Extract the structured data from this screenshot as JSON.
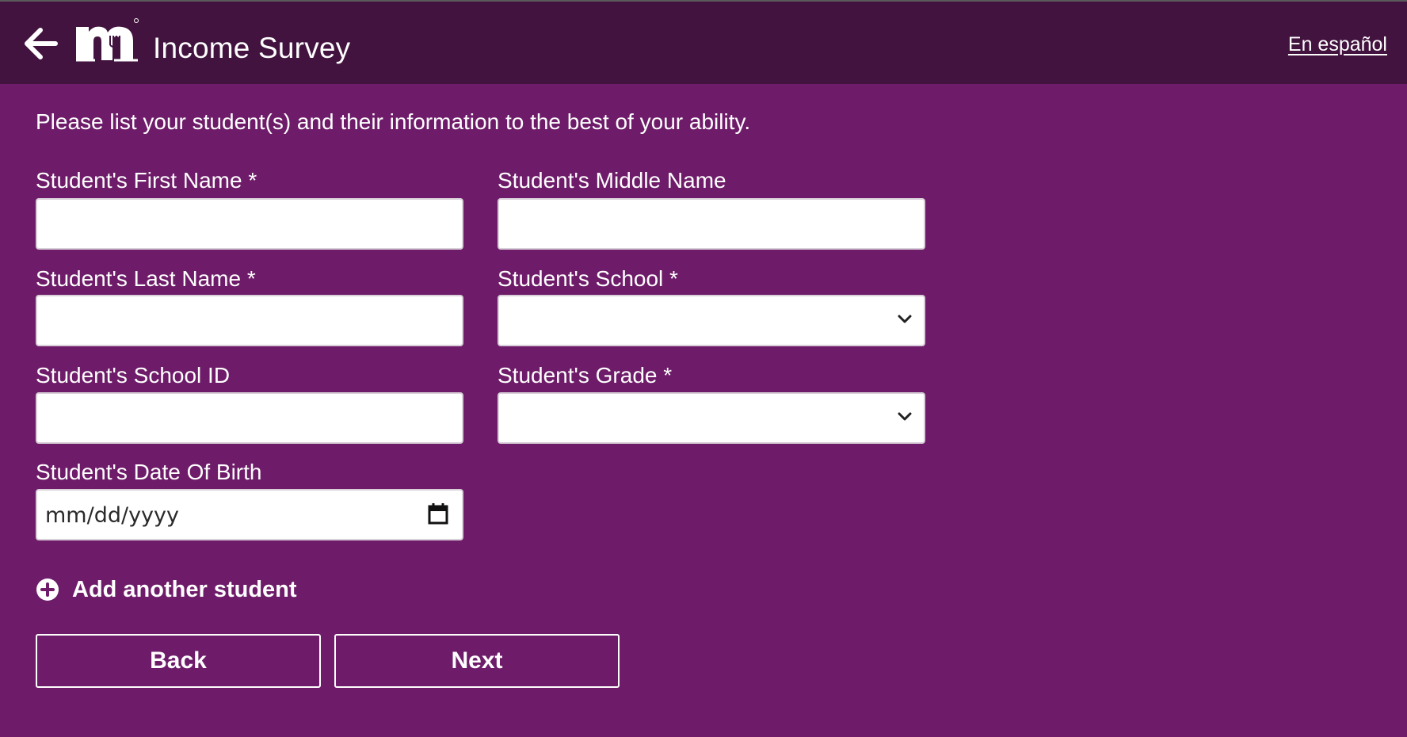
{
  "header": {
    "title": "Income Survey",
    "lang_link": "En español",
    "background": "#42133f"
  },
  "intro": "Please list your student(s) and their information to the best of your ability.",
  "form": {
    "first_name": {
      "label": "Student's First Name *",
      "value": ""
    },
    "middle_name": {
      "label": "Student's Middle Name",
      "value": ""
    },
    "last_name": {
      "label": "Student's Last Name *",
      "value": ""
    },
    "school": {
      "label": "Student's School *",
      "selected": ""
    },
    "school_id": {
      "label": "Student's School ID",
      "value": ""
    },
    "grade": {
      "label": "Student's Grade *",
      "selected": ""
    },
    "dob": {
      "label": "Student's Date Of Birth",
      "placeholder": "mm/dd/yyyy"
    }
  },
  "add_student": "Add another student",
  "buttons": {
    "back": "Back",
    "next": "Next"
  },
  "colors": {
    "page_bg": "#6e1c69",
    "header_bg": "#42133f",
    "text": "#ffffff"
  },
  "icons": [
    "back-arrow-icon",
    "logo-icon",
    "chevron-down-icon",
    "calendar-icon",
    "plus-circle-icon"
  ]
}
